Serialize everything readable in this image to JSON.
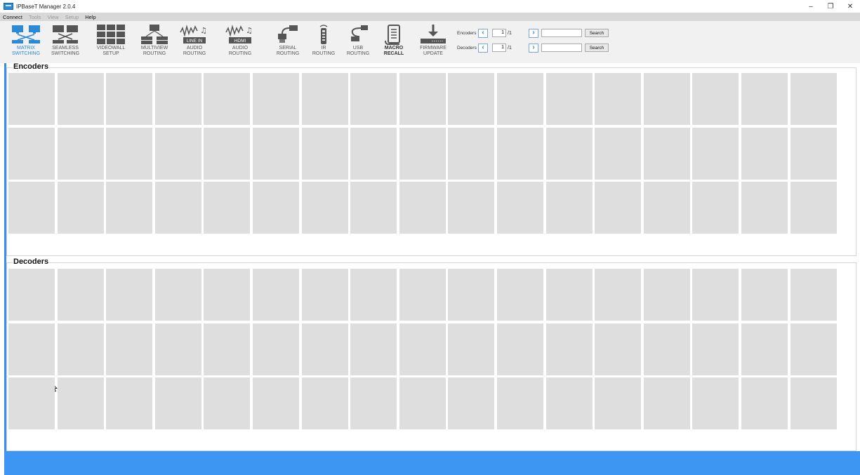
{
  "window": {
    "title": "IPBaseT Manager 2.0.4",
    "minimize_glyph": "–",
    "restore_glyph": "❐",
    "close_glyph": "✕"
  },
  "menu": [
    "Connect",
    "Tools",
    "View",
    "Setup",
    "Help"
  ],
  "toolbar": [
    {
      "label": "MATRIX\nSWITCHING",
      "icon": "matrix-switching-icon",
      "active": true
    },
    {
      "label": "SEAMLESS\nSWITCHING",
      "icon": "seamless-switching-icon"
    },
    {
      "label": "VIDEOWALL\nSETUP",
      "icon": "videowall-icon"
    },
    {
      "label": "MULTIVIEW\nROUTING",
      "icon": "multiview-icon"
    },
    {
      "label": "AUDIO\nROUTING",
      "icon": "line-in-audio-icon",
      "badge": "LINE IN"
    },
    {
      "label": "AUDIO\nROUTING",
      "icon": "hdmi-audio-icon",
      "badge": "HDMI"
    },
    {
      "label": "SERIAL\nROUTING",
      "icon": "serial-icon"
    },
    {
      "label": "IR\nROUTING",
      "icon": "ir-remote-icon"
    },
    {
      "label": "USB\nROUTING",
      "icon": "usb-icon"
    },
    {
      "label": "MACRO\nRECALL",
      "icon": "macro-scroll-icon"
    },
    {
      "label": "FIRMWARE\nUPDATE",
      "icon": "firmware-download-icon"
    }
  ],
  "nav": {
    "encoders": {
      "label": "Encoders",
      "page": "1",
      "total": "/1",
      "search_label": "Search"
    },
    "decoders": {
      "label": "Decoders",
      "page": "1",
      "total": "/1",
      "search_label": "Search"
    }
  },
  "sections": {
    "encoders": {
      "title": "Encoders"
    },
    "decoders": {
      "title": "Decoders"
    }
  },
  "colors": {
    "accent": "#2a8ad8",
    "bottom_bar": "#3c96f2",
    "cell": "#dedede"
  }
}
